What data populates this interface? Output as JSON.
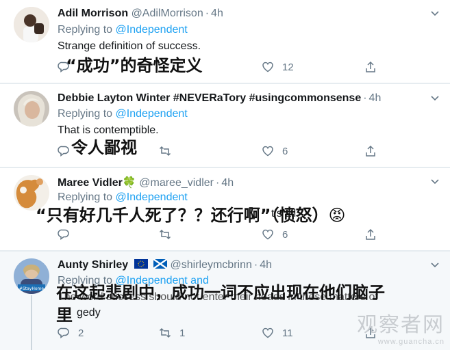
{
  "tweets": [
    {
      "name": "Adil Morrison",
      "handle": "@AdilMorrison",
      "time": "4h",
      "replying_prefix": "Replying to",
      "replying_to": "@Independent",
      "text": "Strange definition of success.",
      "overlay": "“成功”的奇怪定义",
      "replies": "",
      "retweets": "",
      "likes": "12",
      "flags": ""
    },
    {
      "name": "Debbie Layton Winter #NEVERaTory #usingcommonsense",
      "handle": "",
      "time": "4h",
      "replying_prefix": "Replying to",
      "replying_to": "@Independent",
      "text": "That is contemptible.",
      "overlay": "令人鄙视",
      "replies": "",
      "retweets": "",
      "likes": "6",
      "flags": ""
    },
    {
      "name": "Maree Vidler",
      "name_emoji": "🍀",
      "handle": "@maree_vidler",
      "time": "4h",
      "replying_prefix": "Replying to",
      "replying_to": "@Independent",
      "text": "t’s all",
      "overlay": "“只有好几千人死了？？还行啊”（愤怒）😡",
      "replies": "",
      "retweets": "",
      "likes": "6",
      "flags": ""
    },
    {
      "name": "Aunty Shirley",
      "handle": "@shirleymcbrinn",
      "time": "4h",
      "replying_prefix": "Replying to",
      "replying_to": "@Independent and",
      "text": "The word success should not enter their heads in these matters of",
      "text2": "gedy",
      "overlay_line1": "在这起悲剧中，成功一词不应出现在他们脑子",
      "overlay_line2": "里",
      "avatar_badge": "#StayHome",
      "replies": "2",
      "retweets": "1",
      "likes": "11",
      "flags": ""
    }
  ],
  "watermark": {
    "main": "观察者网",
    "url": "www.guancha.cn"
  },
  "colors": {
    "link": "#1da1f2",
    "muted": "#657786",
    "eu_flag": "#003399",
    "scotland_flag": "#005eb8"
  },
  "icons": [
    "reply-icon",
    "retweet-icon",
    "like-icon",
    "share-icon",
    "caret-down-icon",
    "eu-flag-icon",
    "scotland-flag-icon",
    "clover-icon",
    "angry-face-icon"
  ]
}
